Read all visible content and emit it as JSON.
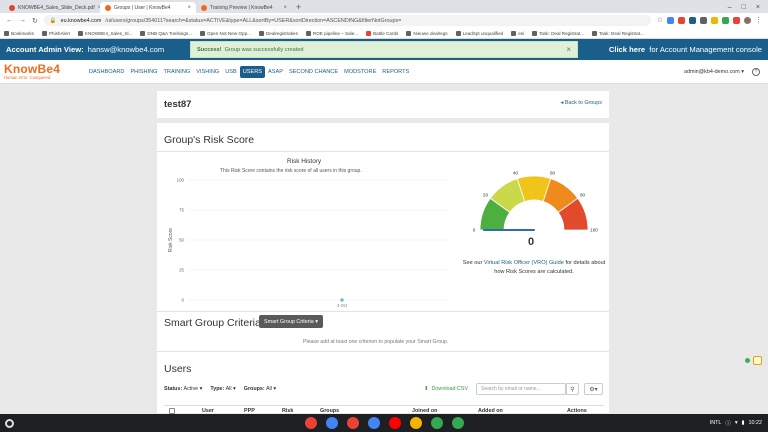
{
  "browser": {
    "tabs": [
      {
        "title": "KNOWBE4_Sales_Slide_Deck.pdf",
        "color": "#db4437",
        "active": false
      },
      {
        "title": "Groups | User | KnowBe4",
        "color": "#f26b1d",
        "active": true
      },
      {
        "title": "Training Preview | KnowBe4",
        "color": "#f26b1d",
        "active": false
      }
    ],
    "new_tab": "+",
    "url_host": "eu.knowbe4.com",
    "url_path": "/ui/users/groups/354011?search=&status=ACTIVE&type=ALL&sortBy=USER&sortDirection=ASCENDING&filterNotGroups=",
    "bookmarks": [
      "Bookmarks",
      "PhishAlert",
      "KNOWBE4_Sales_Sl...",
      "DNB Q&A Toelsings...",
      "Open Not New Opp...",
      "Dealregistraties",
      "ROE pipeline – Sale...",
      "Battle Cards",
      "Nieuwe dealregs",
      "LeadSpt unqualified",
      "esi",
      "Task: Deal Registrat...",
      "Task: Deal Registrat..."
    ]
  },
  "adminbar": {
    "label": "Account Admin View:",
    "user": "hansw@knowbe4.com",
    "toast_bold": "Success!",
    "toast_text": "Group was successfully created",
    "toast_close": "×",
    "console_bold": "Click here",
    "console_text": "for Account Management console"
  },
  "appnav": {
    "logo_name": "KnowBe4",
    "logo_tag": "Human error. Conquered.",
    "items": [
      "DASHBOARD",
      "PHISHING",
      "TRAINING",
      "VISHING",
      "USB",
      "USERS",
      "ASAP",
      "SECOND CHANCE",
      "MODSTORE",
      "REPORTS"
    ],
    "active_index": 5,
    "account": "admin@kb4-demo.com ▾",
    "help": "?"
  },
  "page": {
    "title": "test87",
    "back_link": "◂ Back to Groups",
    "risk_section": "Group's Risk Score",
    "chart_title": "Risk History",
    "chart_subtitle": "This Risk Score contains the risk score of all users in this group.",
    "gauge_value": "0",
    "gauge_note_pre": "See our",
    "gauge_note_link": "Virtual Risk Officer (VRO) Guide",
    "gauge_note_post": "for details about how Risk Scores are calculated.",
    "smart_section": "Smart Group Criteria",
    "smart_button": "Smart Group Criteria ▾",
    "smart_note": "Please add at least one criterion to populate your Smart Group.",
    "users_section": "Users",
    "filters": [
      {
        "label": "Status:",
        "value": "Active ▾"
      },
      {
        "label": "Type:",
        "value": "All ▾"
      },
      {
        "label": "Groups:",
        "value": "All ▾"
      }
    ],
    "download_csv": "Download CSV",
    "search_placeholder": "Search by email or name...",
    "columns": [
      "User",
      "PPP",
      "Risk",
      "Groups",
      "Joined on",
      "Added on",
      "Actions"
    ]
  },
  "chart_data": {
    "type": "line",
    "title": "Risk History",
    "ylabel": "Risk Score",
    "ylim": [
      0,
      100
    ],
    "yticks": [
      0,
      25,
      50,
      75,
      100
    ],
    "x": [
      "4 Oct"
    ],
    "series": [
      {
        "values": [
          0
        ]
      }
    ],
    "grid": true
  },
  "gauge": {
    "value": 0,
    "min": 0,
    "max": 100,
    "ticks": [
      "0",
      "20",
      "40",
      "60",
      "80",
      "100"
    ],
    "segment_colors": [
      "#4caf3f",
      "#c9d94a",
      "#f0c419",
      "#f08a1c",
      "#e24a2c"
    ]
  },
  "taskbar": {
    "locale": "INTL",
    "clock": "10:22",
    "app_colors": [
      "#ea4335",
      "#4285f4",
      "#ea4335",
      "#4285f4",
      "#ff0000",
      "#f4b400",
      "#34a853",
      "#34a853"
    ]
  }
}
